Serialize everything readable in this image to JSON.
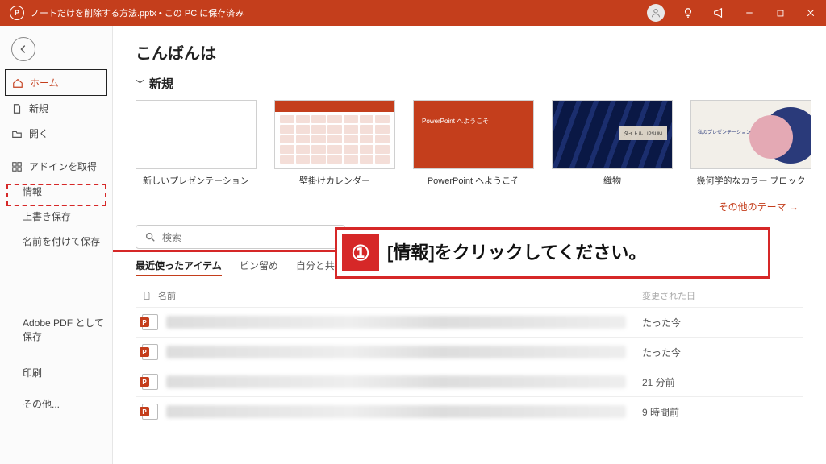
{
  "titlebar": {
    "app_icon_letter": "P",
    "title": "ノートだけを削除する方法.pptx • この PC に保存済み"
  },
  "sidebar": {
    "home": "ホーム",
    "new": "新規",
    "open": "開く",
    "addins": "アドインを取得",
    "info": "情報",
    "save": "上書き保存",
    "saveas": "名前を付けて保存",
    "adobe": "Adobe PDF として保存",
    "print": "印刷",
    "more": "その他..."
  },
  "main": {
    "greeting": "こんばんは",
    "new_section": "新規",
    "templates": [
      {
        "label": "新しいプレゼンテーション"
      },
      {
        "label": "壁掛けカレンダー"
      },
      {
        "label": "PowerPoint へようこそ",
        "inner": "PowerPoint へようこそ"
      },
      {
        "label": "織物",
        "inner": "タイトル LIPSUM"
      },
      {
        "label": "幾何学的なカラー ブロック",
        "inner": "私のプレゼンテーション"
      }
    ],
    "more_themes": "その他のテーマ  →",
    "search_placeholder": "検索",
    "tabs": {
      "recent": "最近使ったアイテム",
      "pinned": "ピン留め",
      "shared": "自分と共有"
    },
    "list_head": {
      "name": "名前",
      "date": "変更された日"
    },
    "rows": [
      {
        "date": "たった今"
      },
      {
        "date": "たった今"
      },
      {
        "date": "21 分前"
      },
      {
        "date": "9 時間前"
      }
    ]
  },
  "annotation": {
    "step_num": "①",
    "text": "[情報]をクリックしてください。"
  }
}
